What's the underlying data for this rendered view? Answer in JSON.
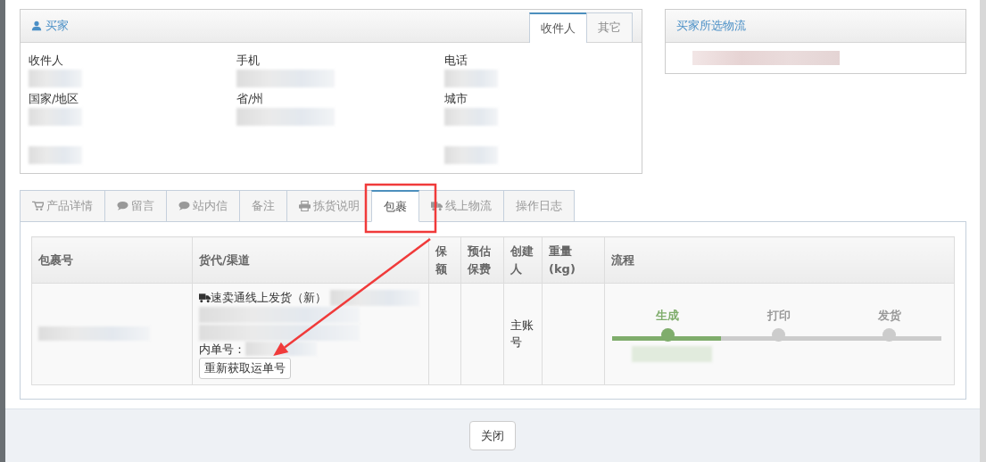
{
  "buyer_panel": {
    "title": "买家",
    "tabs": [
      {
        "label": "收件人",
        "selected": true
      },
      {
        "label": "其它",
        "selected": false
      }
    ],
    "fields": [
      {
        "label": "收件人",
        "hidden_value": true
      },
      {
        "label": "手机",
        "hidden_value": true
      },
      {
        "label": "电话",
        "hidden_value": true
      },
      {
        "label": "国家/地区",
        "hidden_value": true
      },
      {
        "label": "省/州",
        "hidden_value": true
      },
      {
        "label": "城市",
        "hidden_value": true
      },
      {
        "hidden_value": true
      },
      {
        "hidden_value": false
      },
      {
        "hidden_value": true
      }
    ]
  },
  "logistics_panel": {
    "title": "买家所选物流",
    "hidden_value": true
  },
  "tabs": [
    {
      "label": "产品详情",
      "selected": false
    },
    {
      "label": "留言",
      "selected": false
    },
    {
      "label": "站内信",
      "selected": false
    },
    {
      "label": "备注",
      "selected": false
    },
    {
      "label": "拣货说明",
      "selected": false
    },
    {
      "label": "包裹",
      "selected": true
    },
    {
      "label": "线上物流",
      "selected": false
    },
    {
      "label": "操作日志",
      "selected": false
    }
  ],
  "table": {
    "columns": [
      "包裹号",
      "货代/渠道",
      "保额",
      "预估保费",
      "创建人",
      "重量(kg)",
      "流程"
    ],
    "rows": [
      {
        "package_no_hidden": true,
        "channel": "速卖通线上发货（新）",
        "internal_no_label": "内单号：",
        "refetch_button": "重新获取运单号",
        "creator": "主账号",
        "flow": {
          "level": 0.33,
          "steps": [
            {
              "label": "生成",
              "done": true
            },
            {
              "label": "打印",
              "done": false
            },
            {
              "label": "发货",
              "done": false
            }
          ],
          "time_hidden": true
        }
      }
    ]
  },
  "annotation": {
    "highlight": true,
    "arrow": true
  },
  "footer": {
    "close_button": "关闭"
  }
}
